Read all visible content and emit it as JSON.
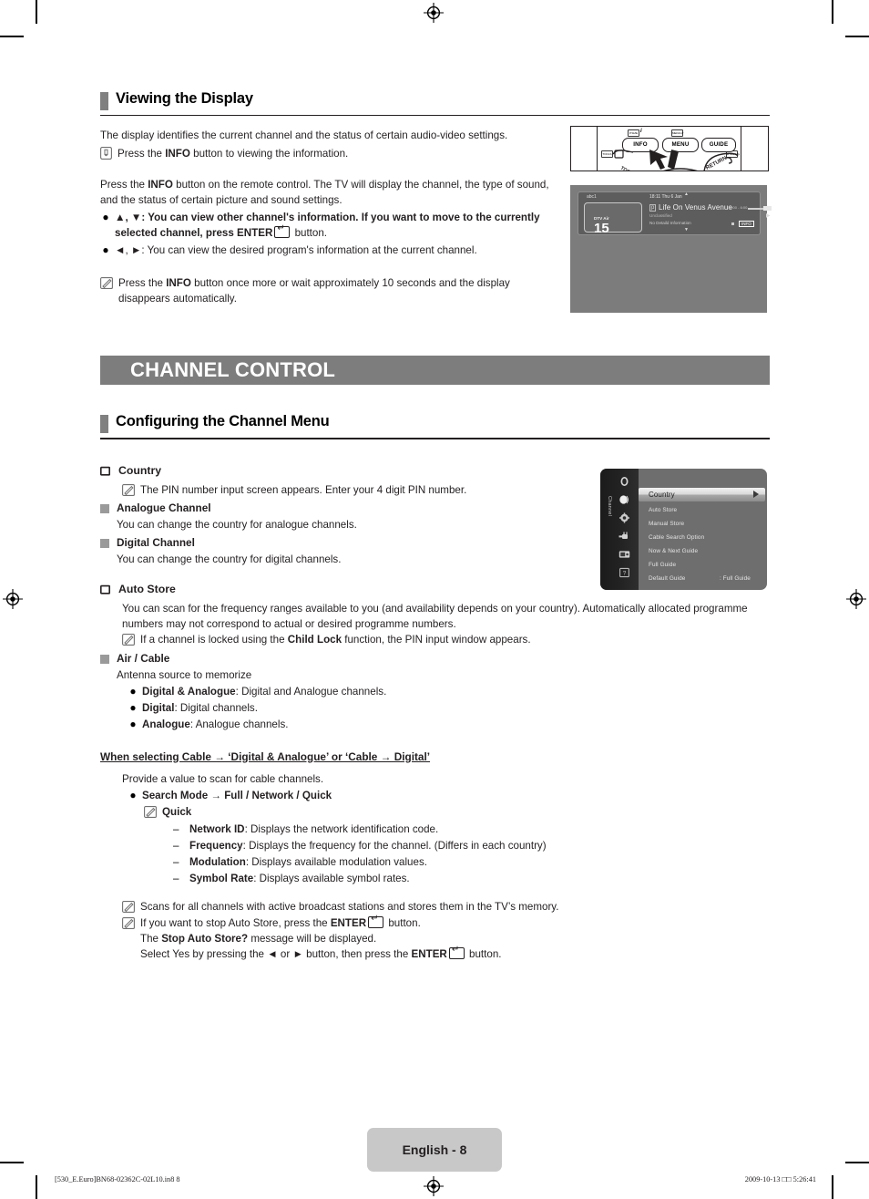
{
  "page": {
    "footer_label": "English - 8",
    "footer_left": "[530_E.Euro]BN68-02362C-02L10.in8   8",
    "footer_right": "2009-10-13   □□ 5:26:41"
  },
  "section1": {
    "heading": "Viewing the Display",
    "intro": "The display identifies the current channel and the status of certain audio-video settings.",
    "note1_a": "Press the ",
    "note1_b": "INFO",
    "note1_c": " button to viewing the information.",
    "para2_a": "Press the ",
    "para2_b": "INFO",
    "para2_c": " button on the remote control. The TV will display the channel, the type of sound, and the status of certain picture and sound settings.",
    "bullet1_a": "▲, ▼: You can view other channel's information. If you want to move to the currently selected channel, press ",
    "bullet1_b": "ENTER",
    "bullet1_c": " button.",
    "bullet2": "◄, ►: You can view the desired program's information at the current channel.",
    "note2_a": "Press the ",
    "note2_b": "INFO",
    "note2_c": " button once more or wait approximately 10 seconds and the display disappears automatically."
  },
  "band": {
    "title": "CHANNEL CONTROL"
  },
  "section2": {
    "heading": "Configuring the Channel Menu",
    "country": {
      "title": "Country",
      "note": "The PIN number input screen appears. Enter your 4 digit PIN number.",
      "sub1_title": "Analogue Channel",
      "sub1_text": "You can change the country for analogue channels.",
      "sub2_title": "Digital Channel",
      "sub2_text": "You can change the country for digital channels."
    },
    "autostore": {
      "title": "Auto Store",
      "text": "You can scan for the frequency ranges available to you (and availability depends on your country). Automatically allocated programme numbers may not correspond to actual or desired programme numbers.",
      "note_a": "If a channel is locked using the ",
      "note_b": "Child Lock",
      "note_c": " function, the PIN input window appears.",
      "sub_title": "Air / Cable",
      "sub_text": "Antenna source to memorize",
      "options": [
        {
          "label": "Digital & Analogue",
          "desc": ": Digital and Analogue channels."
        },
        {
          "label": "Digital",
          "desc": ": Digital channels."
        },
        {
          "label": "Analogue",
          "desc": ": Analogue channels."
        }
      ]
    },
    "cable": {
      "heading": "When selecting Cable → ‘Digital & Analogue’ or ‘Cable → Digital’",
      "text": "Provide a value to scan for cable channels.",
      "search_mode": "Search Mode → Full / Network / Quick",
      "quick": "Quick",
      "items": [
        {
          "label": "Network ID",
          "desc": ": Displays the network identification code."
        },
        {
          "label": "Frequency",
          "desc": ": Displays the frequency for the channel. (Differs in each country)"
        },
        {
          "label": "Modulation",
          "desc": ": Displays available modulation values."
        },
        {
          "label": "Symbol Rate",
          "desc": ": Displays available symbol rates."
        }
      ],
      "note1": "Scans for all channels with active broadcast stations and stores them in the TV’s memory.",
      "note2_a": "If you want to stop Auto Store, press the ",
      "note2_b": "ENTER",
      "note2_c": " button.",
      "note2_line2_a": "The ",
      "note2_line2_b": "Stop Auto Store?",
      "note2_line2_c": " message will be displayed.",
      "note2_line3_a": "Select Yes by pressing the ◄ or ► button, then press the ",
      "note2_line3_b": "ENTER",
      "note2_line3_c": " button."
    }
  },
  "remote_image": {
    "keys": [
      "INFO",
      "MENU",
      "GUIDE",
      "RETURN"
    ],
    "mini_labels": [
      "P.SIZE",
      "MEDIA.P",
      "TOOLS",
      "E.SAVING"
    ]
  },
  "tv_display_image": {
    "channel_name": "abc1",
    "clock": "18:11 Thu 6 Jan",
    "source": "DTV Air",
    "channel_number": "15",
    "rating": "p",
    "programme": "Life On Venus Avenue",
    "classification": "Unclassified",
    "detail": "No Detaild Information",
    "time_range": "18:00 - 6:00",
    "badge": "INFO"
  },
  "tv_menu_image": {
    "sidebar_label": "Channel",
    "items": [
      {
        "label": "Country",
        "value": "",
        "selected": true
      },
      {
        "label": "Auto Store",
        "value": "",
        "selected": false
      },
      {
        "label": "Manual Store",
        "value": "",
        "selected": false
      },
      {
        "label": "Cable Search Option",
        "value": "",
        "selected": false
      },
      {
        "label": "Now & Next Guide",
        "value": "",
        "selected": false
      },
      {
        "label": "Full Guide",
        "value": "",
        "selected": false
      },
      {
        "label": "Default Guide",
        "value": ": Full Guide",
        "selected": false
      }
    ]
  },
  "colors": {
    "band_bg": "#7d7d7d",
    "heading_bar": "#808080",
    "footer_badge": "#c8c8c8",
    "text": "#231f20"
  }
}
